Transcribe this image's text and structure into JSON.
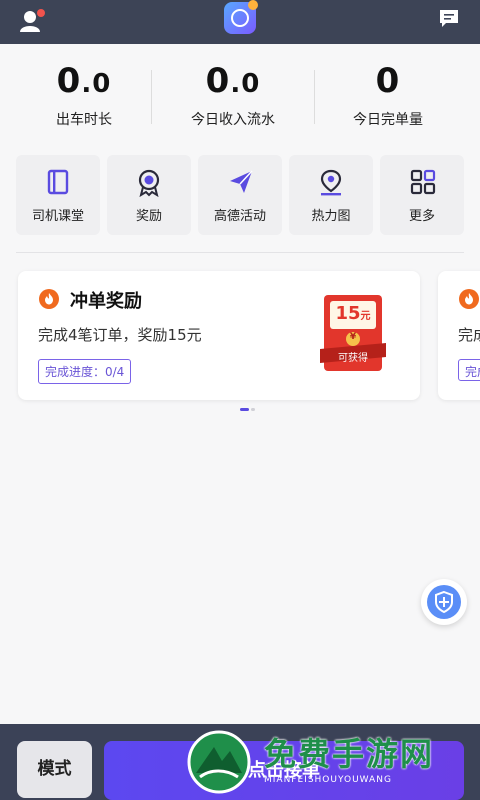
{
  "stats": [
    {
      "int": "0",
      "dec": ".0",
      "label": "出车时长"
    },
    {
      "int": "0",
      "dec": ".0",
      "label": "今日收入流水"
    },
    {
      "int": "0",
      "dec": "",
      "label": "今日完单量"
    }
  ],
  "menu": [
    {
      "label": "司机课堂",
      "icon": "book-icon"
    },
    {
      "label": "奖励",
      "icon": "medal-icon"
    },
    {
      "label": "高德活动",
      "icon": "paper-plane-icon"
    },
    {
      "label": "热力图",
      "icon": "location-pin-icon"
    },
    {
      "label": "更多",
      "icon": "grid-icon"
    }
  ],
  "reward_card": {
    "title": "冲单奖励",
    "desc": "完成4笔订单，奖励15元",
    "progress": "完成进度：0/4",
    "envelope_amount": "15",
    "envelope_unit": "元",
    "envelope_coin": "¥",
    "envelope_caption": "可获得"
  },
  "reward_card_next": {
    "desc_partial": "完成",
    "progress_partial": "完成"
  },
  "bottom": {
    "mode_label": "模式",
    "go_label": "点击接单"
  },
  "watermark": {
    "text": "免费手游网",
    "sub": "MIANFEISHOUYOUWANG"
  },
  "colors": {
    "topbar": "#3d4456",
    "accent": "#5c48f0",
    "reward_orange": "#f06a1f",
    "envelope_red": "#e2362c"
  }
}
